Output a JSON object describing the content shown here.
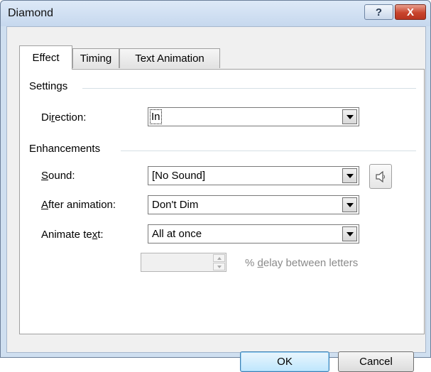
{
  "window": {
    "title": "Diamond"
  },
  "title_buttons": {
    "help": "?",
    "close": "X"
  },
  "tabs": [
    {
      "label": "Effect",
      "active": true
    },
    {
      "label": "Timing",
      "active": false
    },
    {
      "label": "Text Animation",
      "active": false
    }
  ],
  "settings": {
    "group_title": "Settings",
    "direction": {
      "label_pre": "Di",
      "label_ul": "r",
      "label_post": "ection:",
      "value": "In"
    }
  },
  "enhancements": {
    "group_title": "Enhancements",
    "sound": {
      "label_pre": "",
      "label_ul": "S",
      "label_post": "ound:",
      "value": "[No Sound]"
    },
    "after_animation": {
      "label_pre": "",
      "label_ul": "A",
      "label_post": "fter animation:",
      "value": "Don't Dim"
    },
    "animate_text": {
      "label_pre": "Animate te",
      "label_ul": "x",
      "label_post": "t:",
      "value": "All at once"
    },
    "delay": {
      "value": "",
      "label_pre": "% ",
      "label_ul": "d",
      "label_post": "elay between letters",
      "enabled": false
    },
    "sound_icon": "speaker-icon"
  },
  "buttons": {
    "ok": "OK",
    "cancel": "Cancel"
  },
  "colors": {
    "titlebar": "#c6d8ee",
    "close": "#c9442d",
    "default_button": "#bee6fd"
  }
}
